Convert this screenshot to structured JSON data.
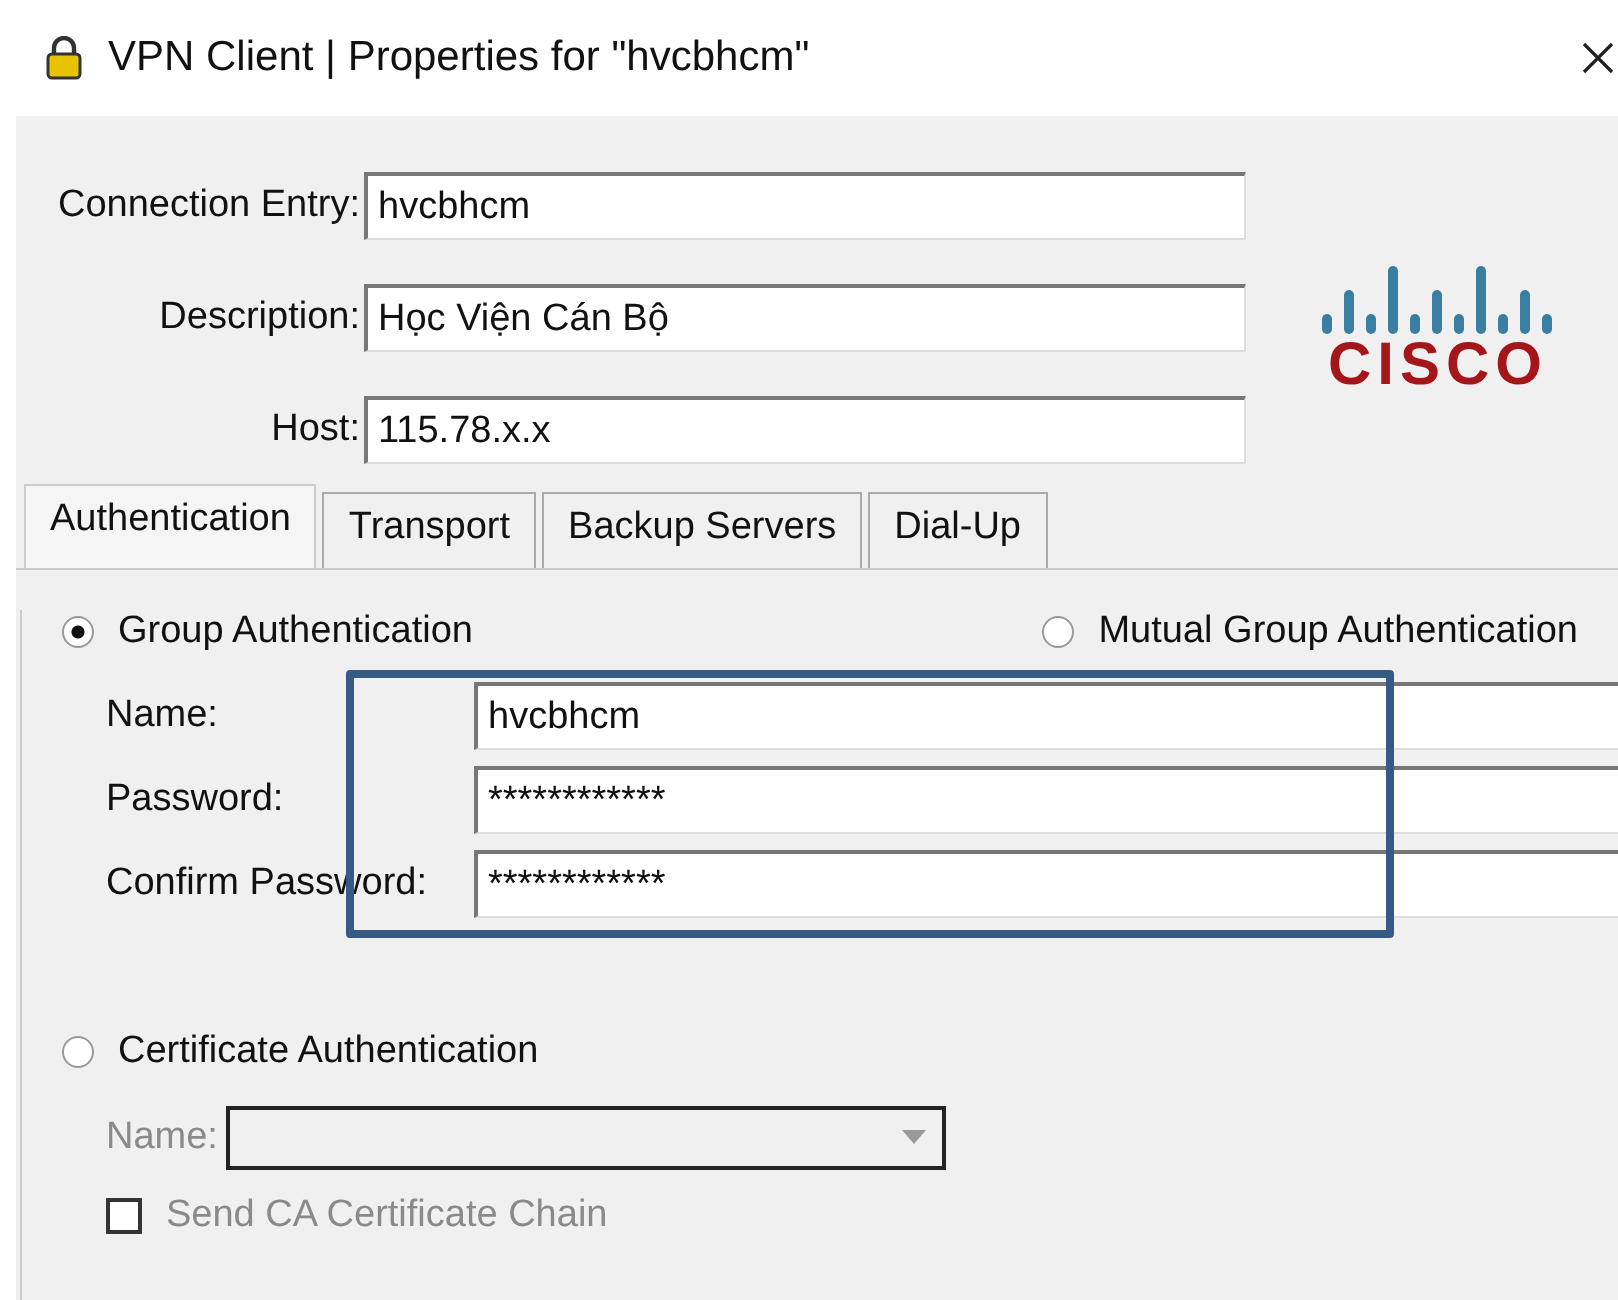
{
  "window": {
    "title": "VPN Client  |  Properties for \"hvcbhcm\""
  },
  "entry_fields": [
    {
      "label": "Connection Entry:",
      "value": "hvcbhcm"
    },
    {
      "label": "Description:",
      "value": "Học Viện Cán Bộ"
    },
    {
      "label": "Host:",
      "value": "115.78.x.x"
    }
  ],
  "logo": {
    "text": "CISCO"
  },
  "tabs": [
    {
      "label": "Authentication",
      "selected": true
    },
    {
      "label": "Transport",
      "selected": false
    },
    {
      "label": "Backup Servers",
      "selected": false
    },
    {
      "label": "Dial-Up",
      "selected": false
    }
  ],
  "group_auth": {
    "label": "Group Authentication",
    "selected": true
  },
  "mutual_auth": {
    "label": "Mutual Group Authentication",
    "selected": false
  },
  "group_fields": [
    {
      "label": "Name:",
      "value": "hvcbhcm"
    },
    {
      "label": "Password:",
      "value": "************"
    },
    {
      "label": "Confirm Password:",
      "value": "************"
    }
  ],
  "cert_auth": {
    "label": "Certificate Authentication",
    "selected": false
  },
  "cert_name": {
    "label": "Name:",
    "disabled": true
  },
  "ca_chain": {
    "label": "Send CA Certificate Chain",
    "checked": false,
    "disabled": true
  }
}
